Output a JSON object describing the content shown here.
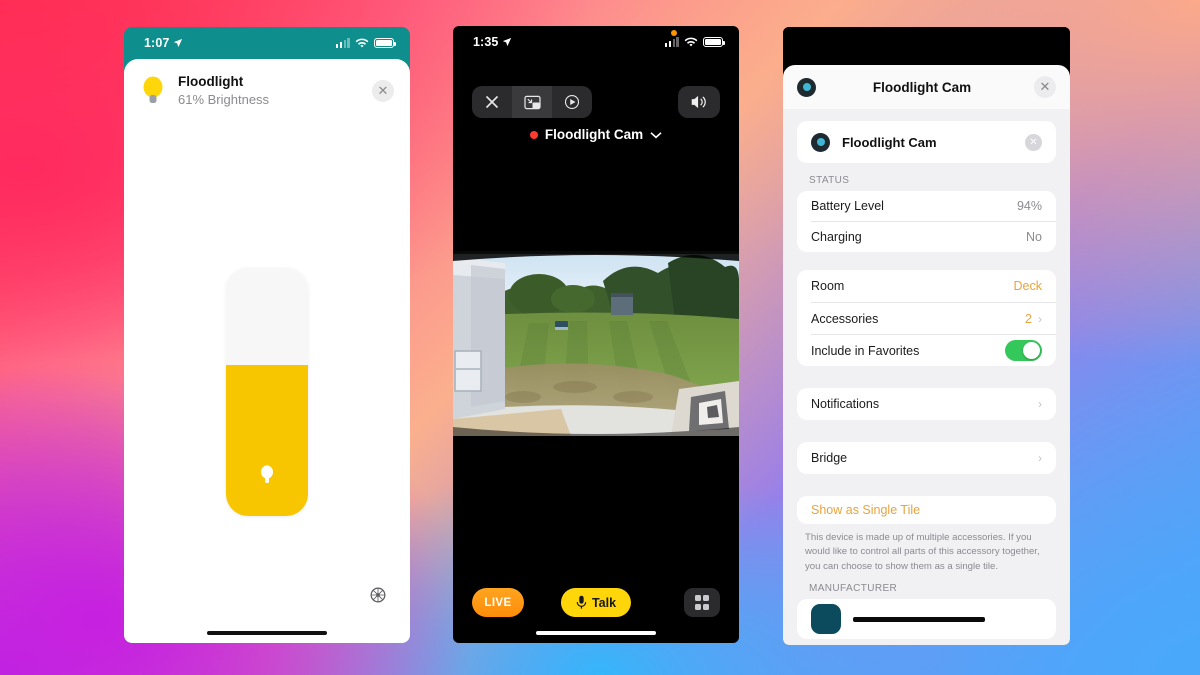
{
  "background": {
    "gradient_colors": [
      "#ff3b5c",
      "#ff6f8c",
      "#fbb08d",
      "#b224e8",
      "#4aa8fb",
      "#35b6fb"
    ]
  },
  "phone_left": {
    "status_bar": {
      "time": "1:07",
      "location_icon": "location-arrow-icon",
      "signal_icon": "cellular-signal-icon",
      "wifi_icon": "wifi-icon",
      "battery_icon": "battery-icon"
    },
    "header": {
      "icon": "lightbulb-icon",
      "title": "Floodlight",
      "subtitle": "61% Brightness",
      "close_label": "✕"
    },
    "slider": {
      "name": "brightness-slider",
      "value": 61,
      "min": 0,
      "max": 100,
      "fill_color": "#f7c600",
      "track_color": "#f7f7f7",
      "thumb_icon": "lightbulb-icon"
    },
    "settings_icon": "gear-icon",
    "accent_teal": "#0e8f8d"
  },
  "phone_mid": {
    "status_bar": {
      "time": "1:35",
      "location_icon": "location-arrow-icon",
      "signal_icon": "cellular-signal-icon",
      "wifi_icon": "wifi-icon",
      "battery_icon": "battery-icon",
      "privacy_dot": "orange-recording-dot"
    },
    "toolbar": {
      "close_icon": "close-x-icon",
      "pip_icon": "picture-in-picture-icon",
      "airplay_icon": "airplay-playback-icon",
      "speaker_icon": "speaker-volume-icon"
    },
    "camera": {
      "recording_indicator": "red-record-dot",
      "name": "Floodlight Cam",
      "chevron_icon": "chevron-down-icon",
      "stream_description": "Backyard lawn view with house siding at left, trees and sky in background"
    },
    "controls": {
      "live_label": "LIVE",
      "live_color": "#ff9500",
      "talk_label": "Talk",
      "talk_icon": "microphone-icon",
      "talk_color": "#ffd60a",
      "grid_icon": "grid-view-icon"
    }
  },
  "phone_right": {
    "nav": {
      "icon": "camera-accessory-icon",
      "title": "Floodlight Cam",
      "close_label": "✕"
    },
    "accessory": {
      "icon": "camera-accessory-icon",
      "name": "Floodlight Cam",
      "close_label": "✕"
    },
    "sections": [
      {
        "title": "STATUS",
        "rows": [
          {
            "label": "Battery Level",
            "value": "94%"
          },
          {
            "label": "Charging",
            "value": "No"
          }
        ]
      }
    ],
    "settings_rows": [
      {
        "label": "Room",
        "value": "Deck",
        "accent": true
      },
      {
        "label": "Accessories",
        "value": "2",
        "accent": true,
        "chevron": true
      },
      {
        "label": "Include in Favorites",
        "toggle": true,
        "toggle_on": true
      }
    ],
    "nav_rows": [
      {
        "label": "Notifications",
        "chevron": true
      },
      {
        "label": "Bridge",
        "chevron": true
      }
    ],
    "single_tile": {
      "link": "Show as Single Tile",
      "description": "This device is made up of multiple accessories. If you would like to control all parts of this accessory together, you can choose to show them as a single tile."
    },
    "manufacturer": {
      "title": "MANUFACTURER",
      "name_redacted": true
    },
    "accent_color": "#e8a33d",
    "toggle_on_color": "#34c759"
  }
}
